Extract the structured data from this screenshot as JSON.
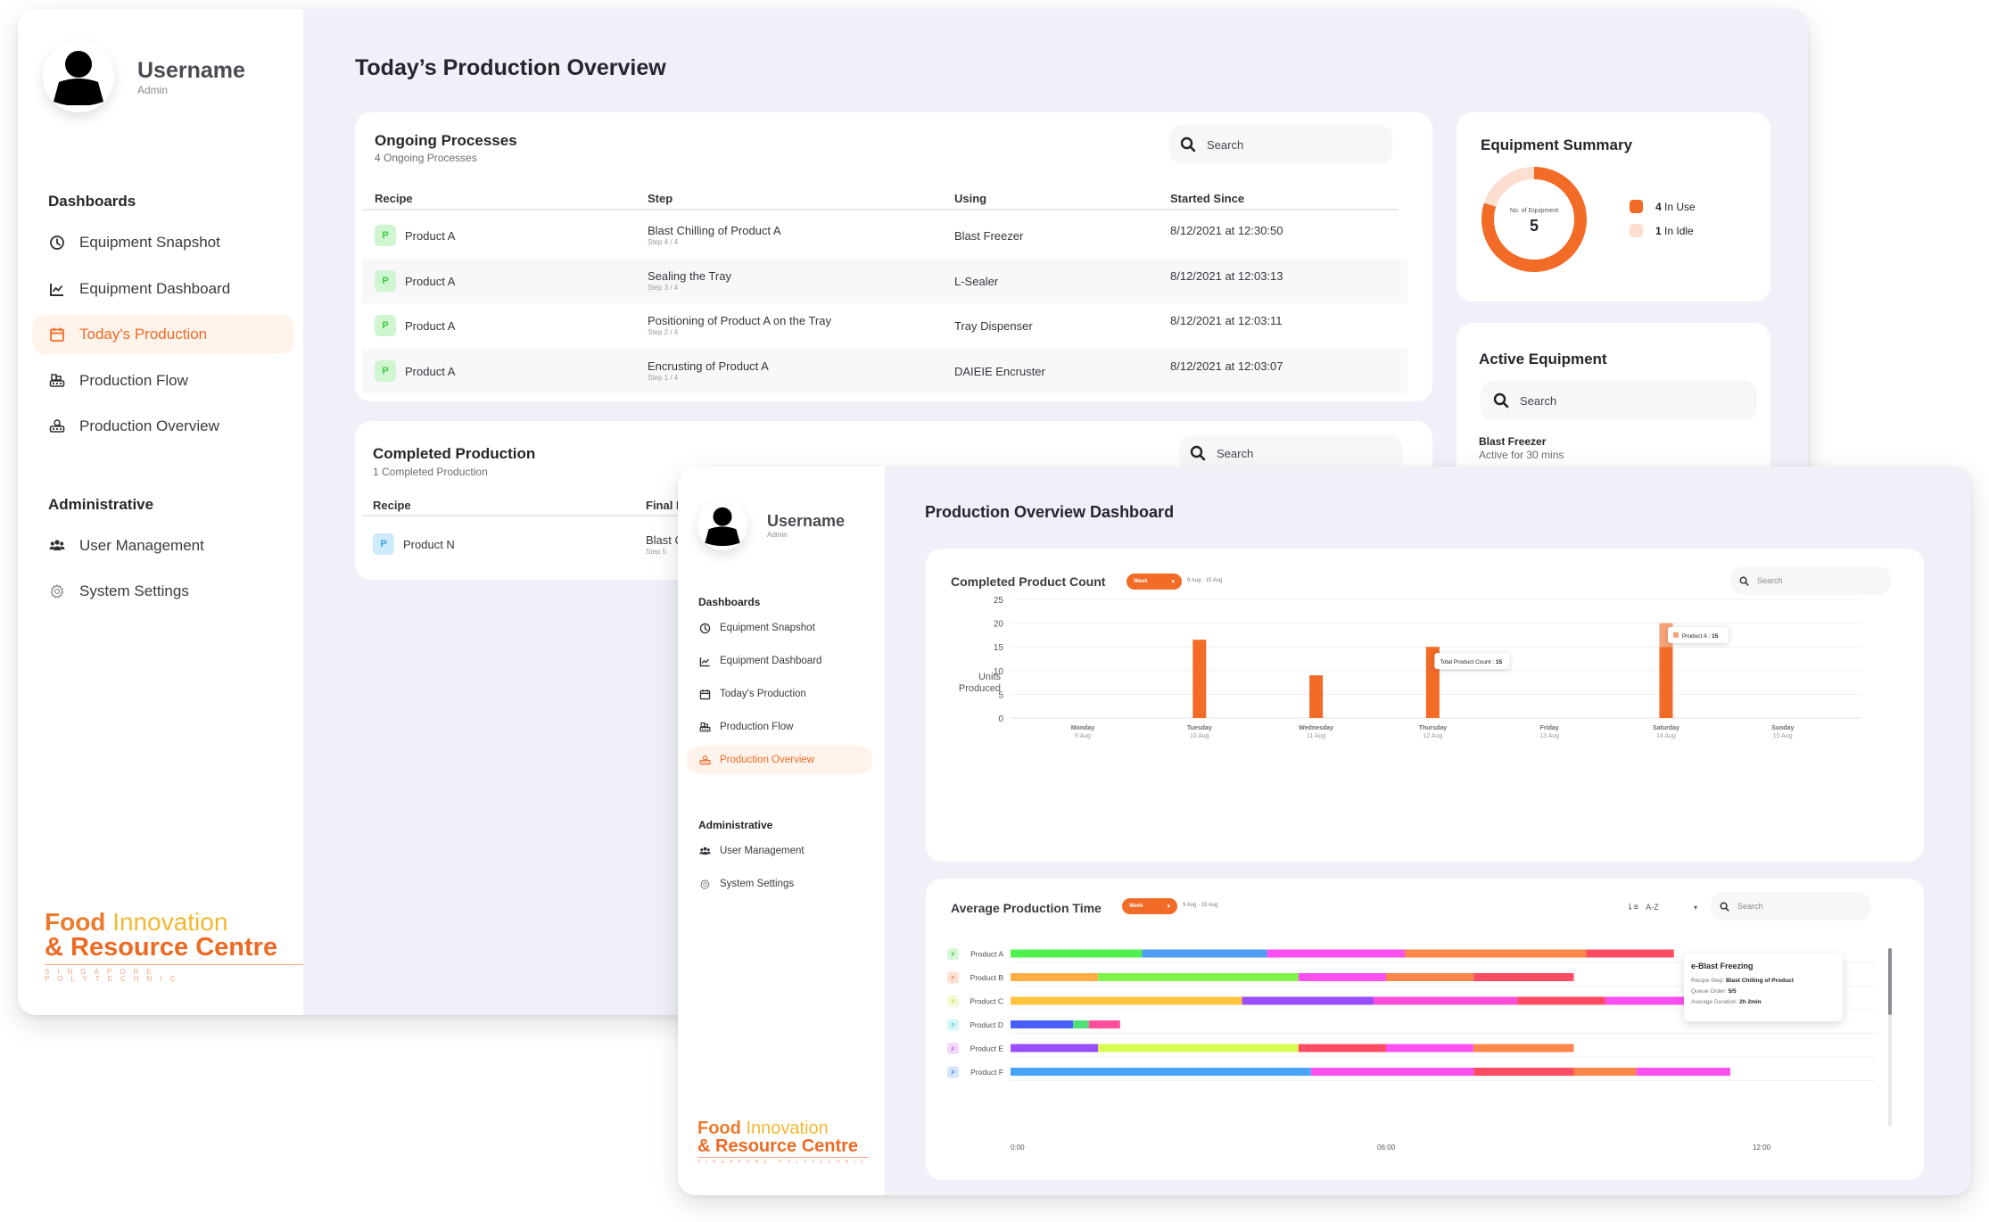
{
  "window1": {
    "user": {
      "name": "Username",
      "role": "Admin"
    },
    "nav_sections": [
      {
        "heading": "Dashboards",
        "items": [
          {
            "label": "Equipment Snapshot",
            "icon": "clock-icon",
            "active": false
          },
          {
            "label": "Equipment Dashboard",
            "icon": "chart-line-icon",
            "active": false
          },
          {
            "label": "Today's Production",
            "icon": "calendar-icon",
            "active": true
          },
          {
            "label": "Production Flow",
            "icon": "conveyor-icon",
            "active": false
          },
          {
            "label": "Production Overview",
            "icon": "conveyor-search-icon",
            "active": false
          }
        ]
      },
      {
        "heading": "Administrative",
        "items": [
          {
            "label": "User Management",
            "icon": "users-icon",
            "active": false
          },
          {
            "label": "System Settings",
            "icon": "gear-icon",
            "active": false
          }
        ]
      }
    ],
    "logo": {
      "line1a": "Food",
      "line1b": "Innovation",
      "line2": "& Resource Centre",
      "line3": "SINGAPORE POLYTECHNIC"
    },
    "page_title": "Today’s Production Overview",
    "ongoing": {
      "title": "Ongoing Processes",
      "subtitle": "4 Ongoing Processes",
      "search_placeholder": "Search",
      "columns": [
        "Recipe",
        "Step",
        "Using",
        "Started Since"
      ],
      "rows": [
        {
          "badge": "P",
          "recipe": "Product A",
          "step": "Blast Chilling of Product A",
          "step_no": "Step 4 / 4",
          "using": "Blast Freezer",
          "started": "8/12/2021 at 12:30:50"
        },
        {
          "badge": "P",
          "recipe": "Product A",
          "step": "Sealing the Tray",
          "step_no": "Step 3 / 4",
          "using": "L-Sealer",
          "started": "8/12/2021 at 12:03:13"
        },
        {
          "badge": "P",
          "recipe": "Product A",
          "step": "Positioning of Product A on the Tray",
          "step_no": "Step 2 / 4",
          "using": "Tray Dispenser",
          "started": "8/12/2021 at 12:03:11"
        },
        {
          "badge": "P",
          "recipe": "Product A",
          "step": "Encrusting of Product A",
          "step_no": "Step 1 / 4",
          "using": "DAIEIE Encruster",
          "started": "8/12/2021 at 12:03:07"
        }
      ]
    },
    "completed": {
      "title": "Completed Production",
      "subtitle": "1 Completed Production",
      "search_placeholder": "Search",
      "columns": [
        "Recipe",
        "Final Process"
      ],
      "columns_visible": [
        "Recipe",
        "Final I"
      ],
      "rows": [
        {
          "badge": "P",
          "recipe": "Product N",
          "step": "Blast C",
          "step_no": "Step 5"
        }
      ]
    },
    "equipment_summary": {
      "title": "Equipment Summary",
      "center_label": "No. of Equipment",
      "total": "5",
      "legend": [
        {
          "count": "4",
          "label": "In Use",
          "color": "#f26b27"
        },
        {
          "count": "1",
          "label": "In Idle",
          "color": "#fcdfd0"
        }
      ],
      "in_use": 4,
      "idle": 1
    },
    "active_equipment": {
      "title": "Active Equipment",
      "search_placeholder": "Search",
      "items": [
        {
          "name": "Blast Freezer",
          "status": "Active for 30 mins"
        }
      ]
    }
  },
  "window2": {
    "user": {
      "name": "Username",
      "role": "Admin"
    },
    "nav_sections": [
      {
        "heading": "Dashboards",
        "items": [
          {
            "label": "Equipment Snapshot",
            "icon": "clock-icon",
            "active": false
          },
          {
            "label": "Equipment Dashboard",
            "icon": "chart-line-icon",
            "active": false
          },
          {
            "label": "Today's Production",
            "icon": "calendar-icon",
            "active": false
          },
          {
            "label": "Production Flow",
            "icon": "conveyor-icon",
            "active": false
          },
          {
            "label": "Production Overview",
            "icon": "conveyor-search-icon",
            "active": true
          }
        ]
      },
      {
        "heading": "Administrative",
        "items": [
          {
            "label": "User Management",
            "icon": "users-icon",
            "active": false
          },
          {
            "label": "System Settings",
            "icon": "gear-icon",
            "active": false
          }
        ]
      }
    ],
    "logo": {
      "line1a": "Food",
      "line1b": "Innovation",
      "line2": "& Resource Centre",
      "line3": "SINGAPORE POLYTECHNIC"
    },
    "page_title": "Production Overview Dashboard",
    "count_card": {
      "period": "Week",
      "range": "9 Aug - 15 Aug",
      "search_placeholder": "Search"
    },
    "time_card": {
      "period": "Week",
      "range": "9 Aug - 15 Aug",
      "sort": "A-Z",
      "search_placeholder": "Search"
    }
  },
  "accent": "#f26b27",
  "chart_data": [
    {
      "type": "bar",
      "title": "Completed Product Count",
      "xlabel": "",
      "ylabel": "Units Produced",
      "ylim": [
        0,
        25
      ],
      "yticks": [
        0,
        5,
        10,
        15,
        20,
        25
      ],
      "grid": true,
      "categories": [
        "Monday",
        "Tuesday",
        "Wednesday",
        "Thursday",
        "Friday",
        "Saturday",
        "Sunday"
      ],
      "category_dates": [
        "9 Aug",
        "10 Aug",
        "11 Aug",
        "12 Aug",
        "13 Aug",
        "14 Aug",
        "15 Aug"
      ],
      "values": [
        0,
        16.5,
        9,
        15,
        0,
        20,
        0
      ],
      "highlight": {
        "category": "Saturday",
        "from": 15,
        "to": 20,
        "label": "Product A",
        "value": "15"
      },
      "annotations": [
        {
          "category": "Thursday",
          "text": "Total Product Count : ",
          "value": "15"
        },
        {
          "category": "Saturday",
          "text": "Product A : ",
          "value": "15"
        }
      ],
      "color": "#f26b27"
    },
    {
      "type": "bar",
      "orientation": "horizontal-stacked",
      "title": "Average Production Time",
      "xlim": [
        0,
        12
      ],
      "xticks": [
        "0:00",
        "06:00",
        "12:00"
      ],
      "xtick_values": [
        0,
        6,
        12
      ],
      "categories": [
        "Product A",
        "Product B",
        "Product C",
        "Product D",
        "Product E",
        "Product F"
      ],
      "badge_colors": [
        [
          "#d7f7d8",
          "#4ccf52"
        ],
        [
          "#fde1d2",
          "#f29a6b"
        ],
        [
          "#f3fbd6",
          "#c5e04c"
        ],
        [
          "#d4f7f5",
          "#5fd3cb"
        ],
        [
          "#f3d9fa",
          "#c46ae0"
        ],
        [
          "#d5e6fb",
          "#5b8fe0"
        ]
      ],
      "series": [
        {
          "name": "Product A",
          "segments": [
            [
              2.1,
              "#4ff04f"
            ],
            [
              2.0,
              "#4f9cf5"
            ],
            [
              2.2,
              "#fb4ff0"
            ],
            [
              2.9,
              "#ff864a"
            ],
            [
              1.4,
              "#ff4c63"
            ]
          ]
        },
        {
          "name": "Product B",
          "segments": [
            [
              1.4,
              "#ffad45"
            ],
            [
              3.2,
              "#7ef44a"
            ],
            [
              1.4,
              "#fb4ff0"
            ],
            [
              1.4,
              "#ff864a"
            ],
            [
              1.6,
              "#ff4c63"
            ]
          ]
        },
        {
          "name": "Product C",
          "segments": [
            [
              3.7,
              "#ffc33d"
            ],
            [
              2.1,
              "#9a4dfa"
            ],
            [
              2.3,
              "#fb4fd9"
            ],
            [
              1.4,
              "#ff4c63"
            ],
            [
              1.4,
              "#fb4ff0"
            ]
          ]
        },
        {
          "name": "Product D",
          "segments": [
            [
              1.0,
              "#4a60fa"
            ],
            [
              0.25,
              "#4fe07a"
            ],
            [
              0.5,
              "#ff4f9a"
            ]
          ]
        },
        {
          "name": "Product E",
          "segments": [
            [
              1.4,
              "#9a4dfa"
            ],
            [
              3.2,
              "#d9fb4f"
            ],
            [
              1.4,
              "#ff4c63"
            ],
            [
              1.4,
              "#fb4ff0"
            ],
            [
              1.6,
              "#ff864a"
            ]
          ]
        },
        {
          "name": "Product F",
          "segments": [
            [
              4.8,
              "#48a4fa"
            ],
            [
              2.6,
              "#fb4ff0"
            ],
            [
              1.6,
              "#ff4c63"
            ],
            [
              1.0,
              "#ff864a"
            ],
            [
              1.5,
              "#fb4ff0"
            ]
          ]
        }
      ],
      "tooltip": {
        "title": "e-Blast Freezing",
        "rows": [
          {
            "label": "Recipe Step: ",
            "value": "Blast Chilling of Product"
          },
          {
            "label": "Queue Order: ",
            "value": "5/5"
          },
          {
            "label": "Average Duration: ",
            "value": "2h 2min"
          }
        ]
      }
    }
  ]
}
